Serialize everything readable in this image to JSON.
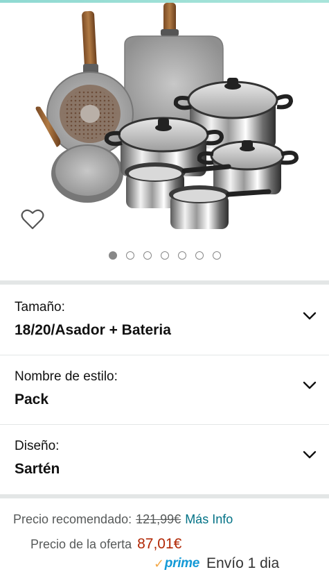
{
  "product": {
    "image_alt": "Juego de sartenes y batería de cocina"
  },
  "gallery": {
    "dots": [
      true,
      false,
      false,
      false,
      false,
      false,
      false
    ]
  },
  "options": [
    {
      "label": "Tamaño:",
      "value": "18/20/Asador + Bateria"
    },
    {
      "label": "Nombre de estilo:",
      "value": "Pack"
    },
    {
      "label": "Diseño:",
      "value": "Sartén"
    }
  ],
  "price": {
    "recommended_label": "Precio recomendado:",
    "recommended_value": "121,99€",
    "more_info": "Más Info",
    "offer_label": "Precio de la oferta",
    "offer_value": "87,01€",
    "prime_text": "prime",
    "shipping": "Envío 1 dia"
  },
  "colors": {
    "accent_teal": "#007185",
    "price_red": "#b12704",
    "prime_blue": "#1399d6",
    "prime_check": "#f3a847",
    "divider": "#e3e6e6"
  },
  "icons": {
    "wishlist": "heart-outline-icon",
    "expand": "chevron-down-icon"
  }
}
